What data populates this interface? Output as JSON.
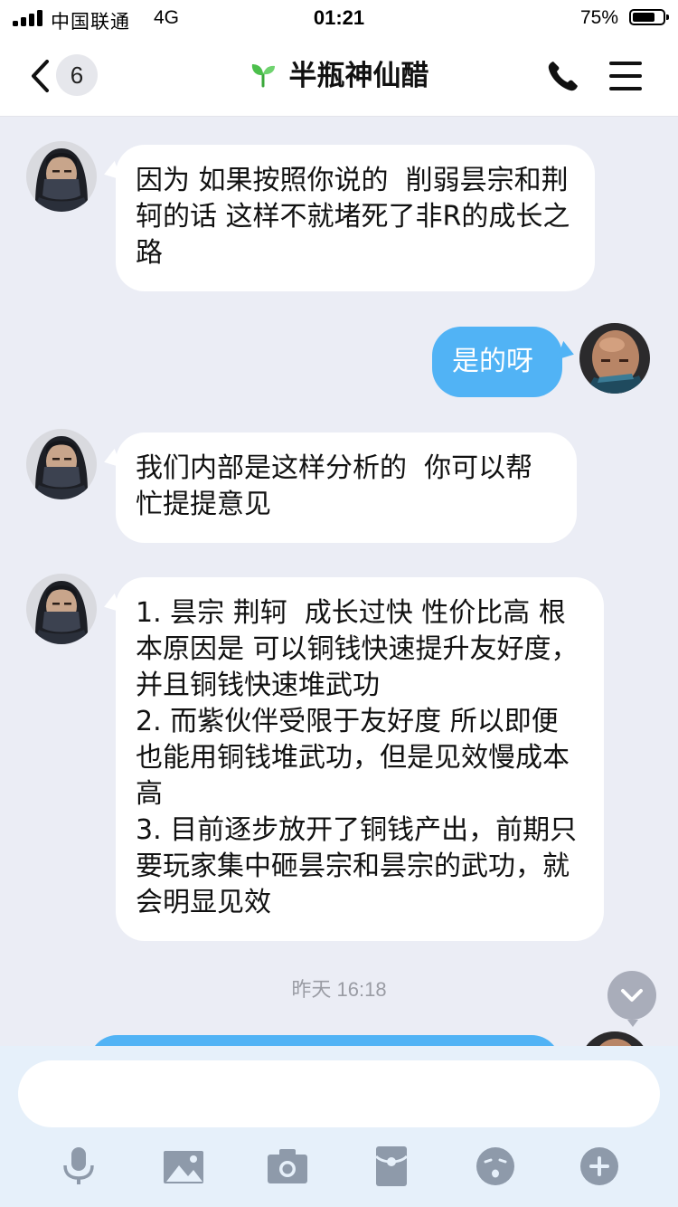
{
  "status_bar": {
    "carrier": "中国联通",
    "network": "4G",
    "time": "01:21",
    "battery_text": "75%",
    "battery_level": 0.75,
    "signal_bars": 4
  },
  "nav": {
    "back_icon": "chevron-left-icon",
    "unread_count": "6",
    "title": "半瓶神仙醋",
    "title_icon": "sprout-icon",
    "call_icon": "phone-icon",
    "menu_icon": "menu-icon"
  },
  "messages": [
    {
      "side": "left",
      "text": "因为 如果按照你说的  削弱昙宗和荆轲的话 这样不就堵死了非R的成长之路"
    },
    {
      "side": "right",
      "text": "是的呀"
    },
    {
      "side": "left",
      "text": "我们内部是这样分析的  你可以帮忙提提意见"
    },
    {
      "side": "left",
      "text": "1. 昙宗 荆轲  成长过快 性价比高 根本原因是 可以铜钱快速提升友好度，并且铜钱快速堆武功\n2. 而紫伙伴受限于友好度 所以即便也能用铜钱堆武功，但是见效慢成本高\n3. 目前逐步放开了铜钱产出，前期只要玩家集中砸昙宗和昙宗的武功，就会明显见效"
    }
  ],
  "timestamp": {
    "day": "昨天",
    "time": "16:18"
  },
  "input": {
    "value": "",
    "placeholder": ""
  },
  "toolbar": [
    {
      "icon": "microphone-icon"
    },
    {
      "icon": "image-icon"
    },
    {
      "icon": "camera-icon"
    },
    {
      "icon": "red-packet-icon"
    },
    {
      "icon": "emoji-icon"
    },
    {
      "icon": "plus-icon"
    }
  ],
  "colors": {
    "background": "#ebedf5",
    "bubble_outgoing": "#51b3f5",
    "bubble_incoming": "#ffffff",
    "input_bar": "#e6f0fa",
    "toolbar_icon": "#8e9aaa",
    "sprout_green": "#4cbf4c"
  }
}
